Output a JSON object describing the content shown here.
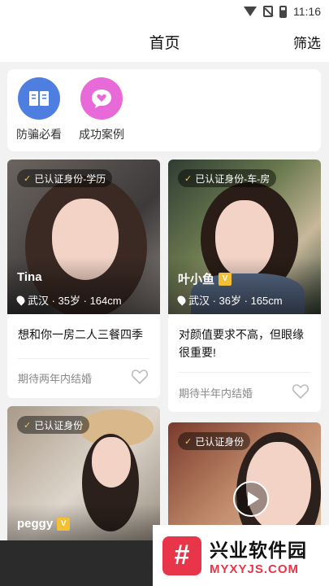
{
  "status": {
    "time": "11:16",
    "icons": [
      "wifi-icon",
      "no-sim-icon",
      "battery-icon"
    ]
  },
  "header": {
    "title": "首页",
    "filter_label": "筛选"
  },
  "quick_actions": [
    {
      "label": "防骗必看",
      "icon": "book-icon",
      "color": "#4e7fe0"
    },
    {
      "label": "成功案例",
      "icon": "heart-chat-icon",
      "color": "#e86ad8"
    }
  ],
  "cards": [
    {
      "badge": "已认证身份-学历",
      "name": "Tina",
      "vip": false,
      "info": "武汉 · 35岁 · 164cm",
      "desc": "想和你一房二人三餐四季",
      "expect": "期待两年内结婚"
    },
    {
      "badge": "已认证身份-车-房",
      "name": "叶小鱼",
      "vip": true,
      "info": "武汉 · 36岁 · 165cm",
      "desc": "对颜值要求不高，但眼缘很重要!",
      "expect": "期待半年内结婚"
    },
    {
      "badge": "已认证身份",
      "name": "peggy",
      "vip": true
    },
    {
      "badge": "已认证身份",
      "video": true
    }
  ],
  "watermark": {
    "logo": "#",
    "title": "兴业软件园",
    "url": "MYXYJS.COM"
  },
  "colors": {
    "accent_badge": "#f3bf33",
    "watermark_red": "#e8354a"
  }
}
